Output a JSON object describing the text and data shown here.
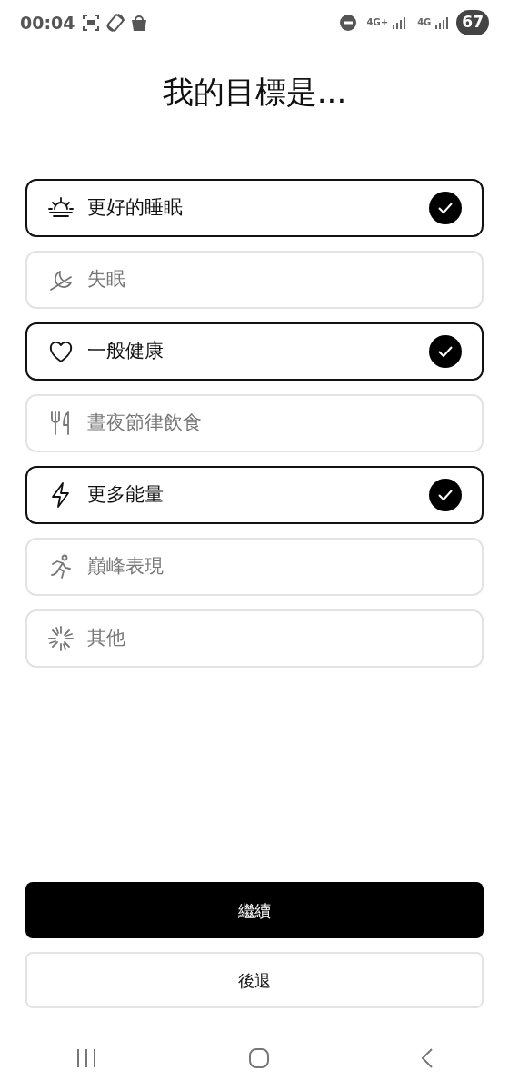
{
  "status_bar": {
    "time": "00:04",
    "network_1": "4G+",
    "network_2": "4G",
    "battery": "67"
  },
  "title": "我的目標是...",
  "goals": [
    {
      "label": "更好的睡眠",
      "selected": true
    },
    {
      "label": "失眠",
      "selected": false
    },
    {
      "label": "一般健康",
      "selected": true
    },
    {
      "label": "晝夜節律飲食",
      "selected": false
    },
    {
      "label": "更多能量",
      "selected": true
    },
    {
      "label": "巔峰表現",
      "selected": false
    },
    {
      "label": "其他",
      "selected": false
    }
  ],
  "buttons": {
    "continue": "繼續",
    "back": "後退"
  }
}
